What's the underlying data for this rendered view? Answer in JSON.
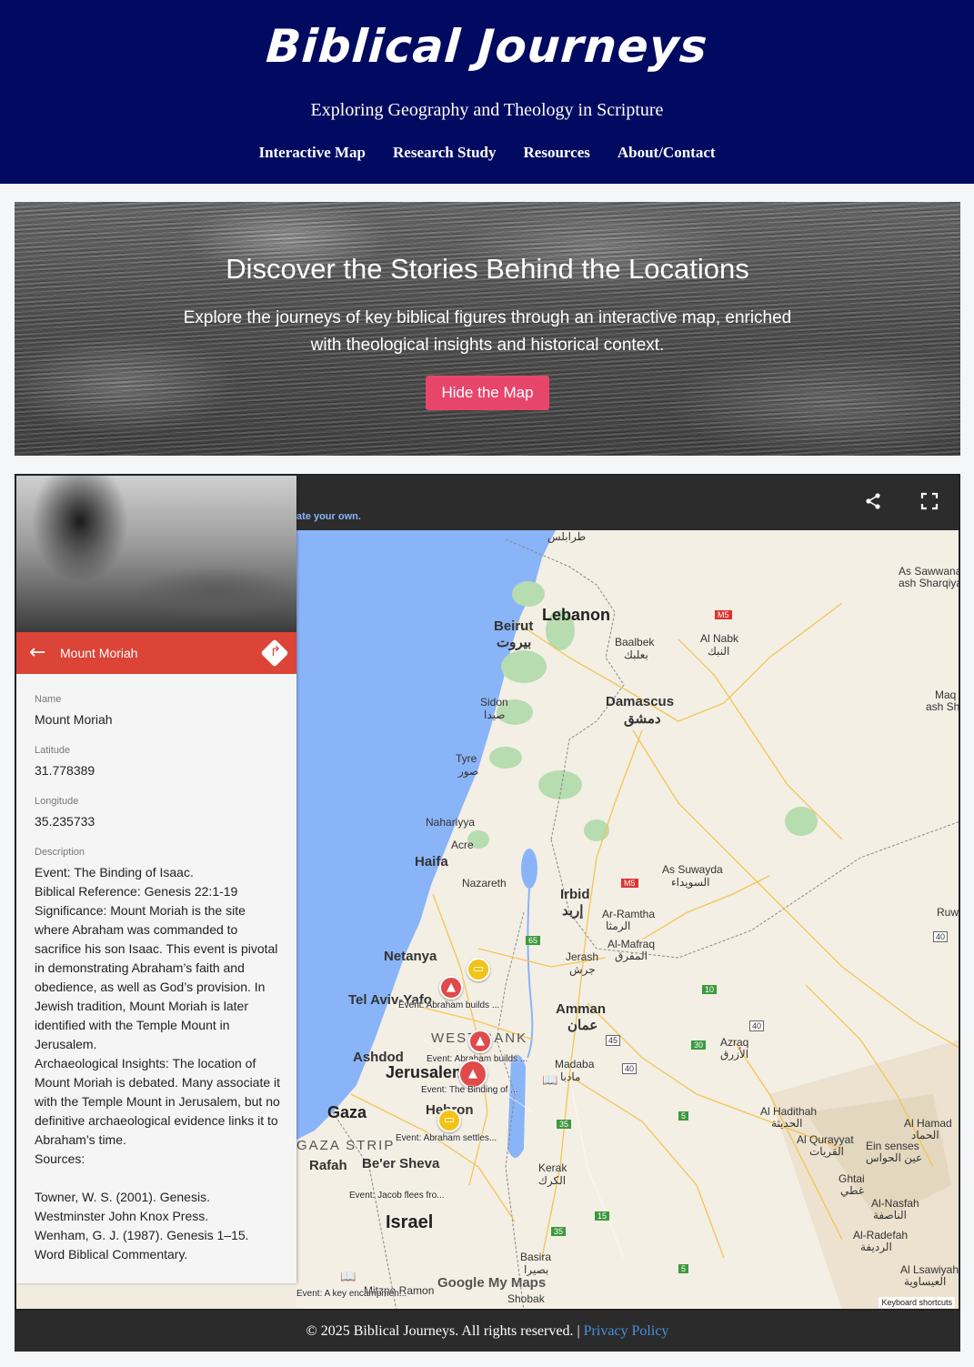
{
  "header": {
    "title": "Biblical Journeys",
    "subtitle": "Exploring Geography and Theology in Scripture",
    "nav": [
      "Interactive Map",
      "Research Study",
      "Resources",
      "About/Contact"
    ]
  },
  "hero": {
    "title": "Discover the Stories Behind the Locations",
    "text": "Explore the journeys of key biblical figures through an interactive map, enriched with theological insights and historical context.",
    "button": "Hide the Map"
  },
  "map": {
    "create_own": "ate your own.",
    "share_icon": "share-icon",
    "fullscreen_icon": "fullscreen-icon",
    "panel": {
      "title": "Mount Moriah",
      "back_icon": "arrow-left-icon",
      "directions_icon": "directions-icon",
      "fields": {
        "name_label": "Name",
        "name_value": "Mount Moriah",
        "lat_label": "Latitude",
        "lat_value": "31.778389",
        "lon_label": "Longitude",
        "lon_value": "35.235733",
        "desc_label": "Description",
        "desc_value": "Event: The Binding of Isaac.\nBiblical Reference: Genesis 22:1-19\nSignificance: Mount Moriah is the site where Abraham was commanded to sacrifice his son Isaac. This event is pivotal in demonstrating Abraham’s faith and obedience, as well as God’s provision. In Jewish tradition, Mount Moriah is later identified with the Temple Mount in Jerusalem.\nArchaeological Insights: The location of Mount Moriah is debated. Many associate it with the Temple Mount in Jerusalem, but no definitive archaeological evidence links it to Abraham’s time.\nSources:\n\nTowner, W. S. (2001). Genesis. Westminster John Knox Press.\nWenham, G. J. (1987). Genesis 1–15. Word Biblical Commentary."
      }
    },
    "labels": {
      "lebanon": "Lebanon",
      "beirut": "Beirut",
      "beirut_ar": "بيروت",
      "baalbek": "Baalbek",
      "baalbek_ar": "بعلبك",
      "al_nabk": "Al Nabk",
      "al_nabk_ar": "النبك",
      "damascus": "Damascus",
      "damascus_ar": "دمشق",
      "sidon": "Sidon",
      "sidon_ar": "صيدا",
      "tyre": "Tyre",
      "tyre_ar": "صور",
      "nahariyya": "Nahariyya",
      "acre": "Acre",
      "haifa": "Haifa",
      "nazareth": "Nazareth",
      "irbid": "Irbid",
      "irbid_ar": "إربد",
      "ar_ramtha": "Ar-Ramtha",
      "ar_ramtha_ar": "الرمثا",
      "al_mafraq": "Al-Mafraq",
      "al_mafraq_ar": "المفرق",
      "as_suwayda": "As Suwayda",
      "as_suwayda_ar": "السويداء",
      "netanya": "Netanya",
      "jerash": "Jerash",
      "jerash_ar": "جرش",
      "tel_aviv": "Tel Aviv-Yafo",
      "amman": "Amman",
      "amman_ar": "عمان",
      "west_bank": "WEST BANK",
      "ashdod": "Ashdod",
      "jerusalem": "Jerusalem",
      "madaba": "Madaba",
      "madaba_ar": "مادبا",
      "hebron": "Hebron",
      "gaza": "Gaza",
      "gaza_strip": "GAZA STRIP",
      "rafah": "Rafah",
      "beer_sheva": "Be'er Sheva",
      "kerak": "Kerak",
      "kerak_ar": "الكرك",
      "israel": "Israel",
      "basira": "Basira",
      "basira_ar": "بصيرا",
      "mitzpe_ramon": "Mitzpe Ramon",
      "shobak": "Shobak",
      "azraq": "Azraq",
      "azraq_ar": "الأزرق",
      "al_hadithah": "Al Hadithah",
      "al_hadithah_ar": "الحديثة",
      "al_qurayyat": "Al Qurayyat",
      "al_qurayyat_ar": "القريات",
      "ein_senses": "Ein senses",
      "ein_senses_ar": "عين الحواس",
      "al_hamad": "Al Hamad",
      "al_hamad_ar": "الحماد",
      "ghtai": "Ghtai",
      "ghtai_ar": "غطي",
      "al_nasfah": "Al-Nasfah",
      "al_nasfah_ar": "الناصفة",
      "al_radefah": "Al-Radefah",
      "al_radefah_ar": "الرديفة",
      "al_lsawiyah": "Al Lsawiyah",
      "al_lsawiyah_ar": "العيساوية",
      "sawwana": "As Sawwana",
      "sawwana2": "ash Sharqiya",
      "maq": "Maq",
      "ash_sh": "ash Sh",
      "ruw": "Ruw",
      "tripoli_ar": "طرابلس",
      "m5": "M5",
      "r65": "65",
      "r15": "15",
      "r35": "35",
      "r10": "10",
      "r30": "30",
      "r40": "40",
      "r45": "45",
      "r5": "5"
    },
    "events": [
      "Event: Abraham builds ...",
      "Event: Abraham builds ...",
      "Event: The Binding of ...",
      "Event: Abraham settles...",
      "Event: Jacob flees fro...",
      "Event: A key encampmen..."
    ],
    "google": "Google My Maps",
    "keyboard": "Keyboard shortcuts"
  },
  "footer": {
    "text": "© 2025 Biblical Journeys. All rights reserved. | ",
    "link": "Privacy Policy"
  }
}
